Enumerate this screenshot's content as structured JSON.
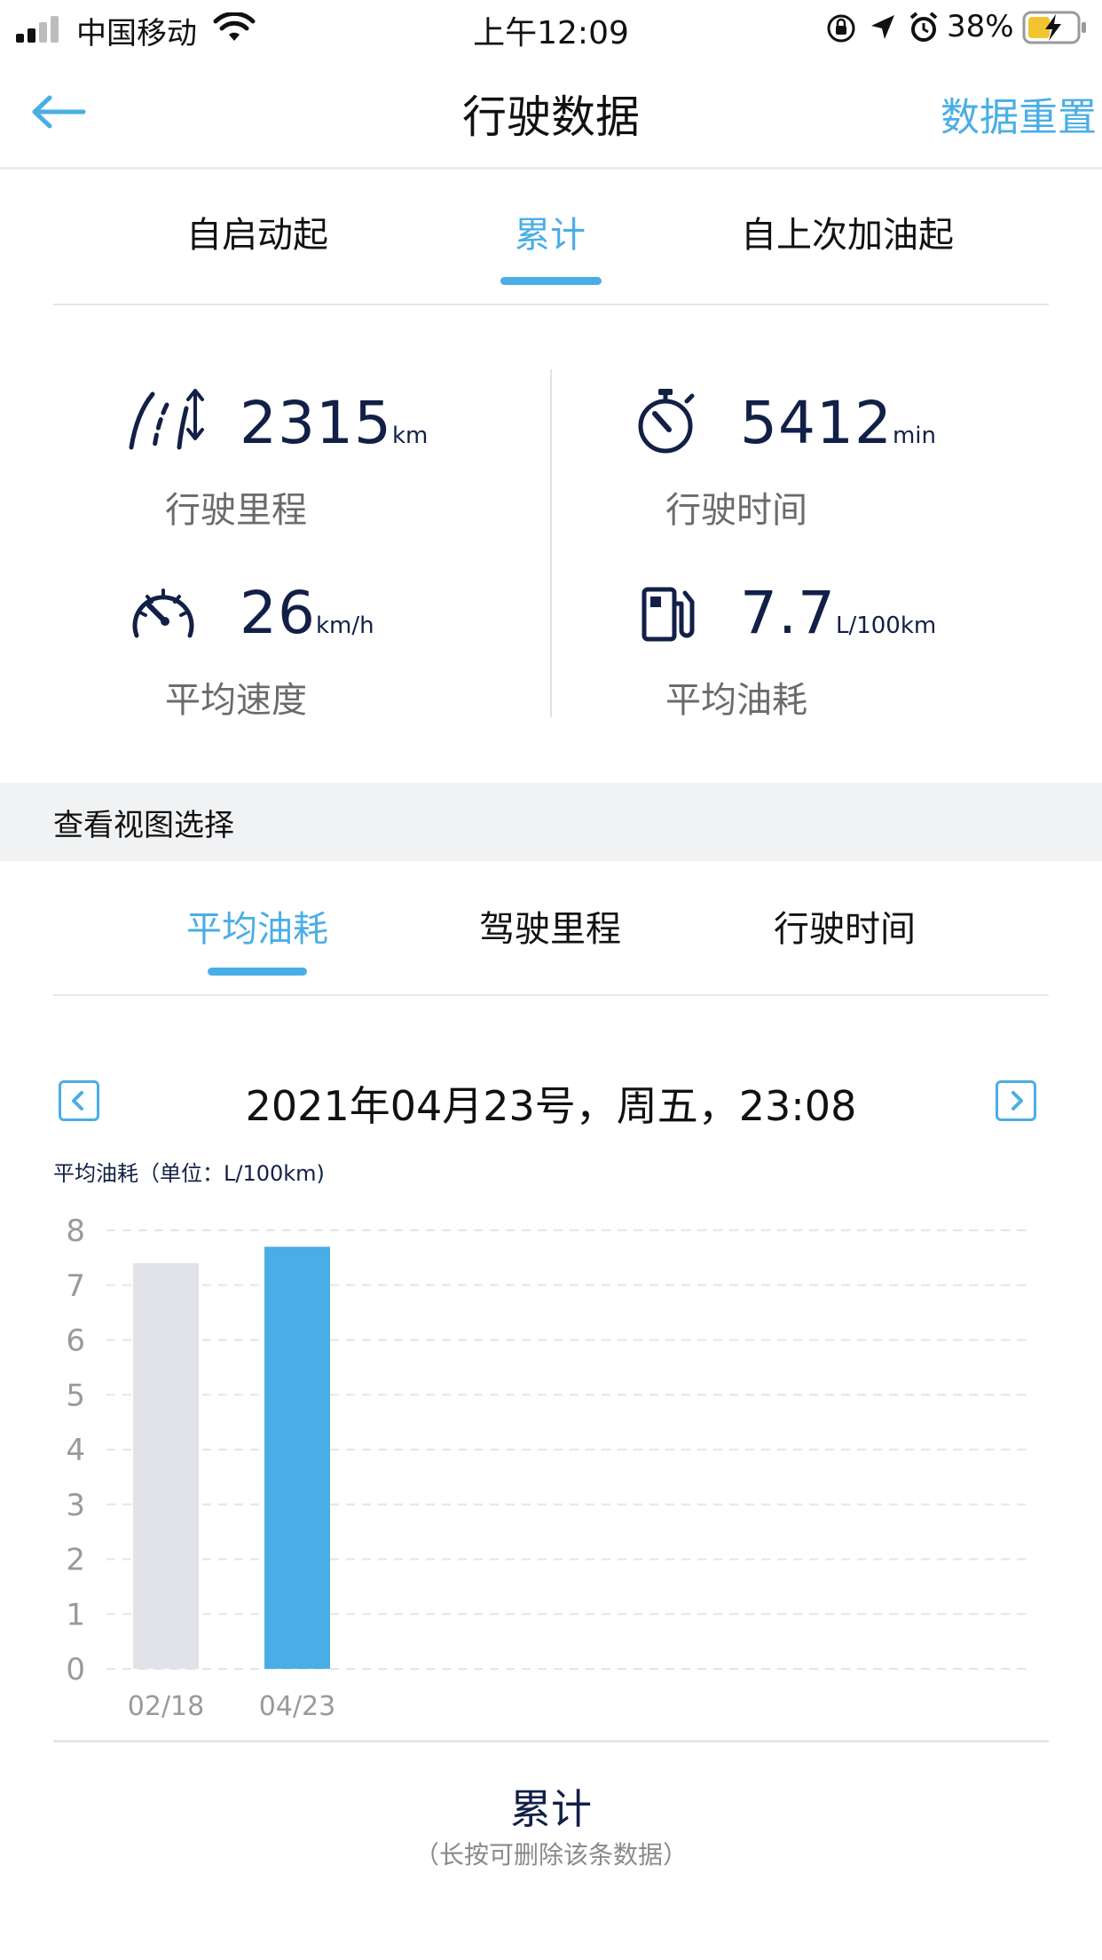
{
  "status_bar": {
    "carrier": "中国移动",
    "time": "上午12:09",
    "battery": "38%"
  },
  "nav": {
    "title": "行驶数据",
    "action": "数据重置"
  },
  "tabs": [
    {
      "label": "自启动起"
    },
    {
      "label": "累计"
    },
    {
      "label": "自上次加油起"
    }
  ],
  "stats": {
    "distance": {
      "value": "2315",
      "unit": "km",
      "label": "行驶里程"
    },
    "time": {
      "value": "5412",
      "unit": "min",
      "label": "行驶时间"
    },
    "speed": {
      "value": "26",
      "unit": "km/h",
      "label": "平均速度"
    },
    "fuel": {
      "value": "7.7",
      "unit": "L/100km",
      "label": "平均油耗"
    }
  },
  "view_select": {
    "title": "查看视图选择",
    "tabs": [
      {
        "label": "平均油耗"
      },
      {
        "label": "驾驶里程"
      },
      {
        "label": "行驶时间"
      }
    ]
  },
  "date_nav": {
    "text": "2021年04月23号，周五，23:08"
  },
  "chart_data": {
    "type": "bar",
    "title": "平均油耗（单位：L/100km)",
    "categories": [
      "02/18",
      "04/23"
    ],
    "values": [
      7.4,
      7.7
    ],
    "ylim": [
      0,
      8
    ],
    "yticks": [
      "0",
      "1",
      "2",
      "3",
      "4",
      "5",
      "6",
      "7",
      "8"
    ],
    "grid": true,
    "colors": {
      "bar": "#e1e3e8",
      "bar_selected": "#4aaee6",
      "tick": "#9a9a9a",
      "grid": "#e3e5ea"
    },
    "selected_index": 1
  },
  "summary": {
    "title": "累计",
    "hint": "（长按可删除该条数据）"
  },
  "colors": {
    "accent": "#4aaee6",
    "navy": "#122047"
  }
}
